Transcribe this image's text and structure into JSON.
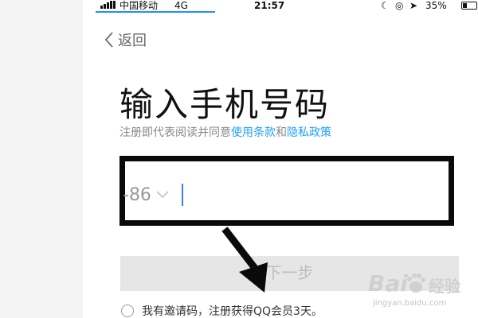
{
  "statusbar": {
    "carrier": "中国移动",
    "network": "4G",
    "time": "21:57",
    "battery": "35%"
  },
  "nav": {
    "back_label": "返回"
  },
  "page": {
    "title": "输入手机号码",
    "agreement_prefix": "注册即代表阅读并同意",
    "terms_link": "使用条款",
    "and_text": "和",
    "privacy_link": "隐私政策"
  },
  "phone_input": {
    "country_code": "-86",
    "value": ""
  },
  "next_button": {
    "label": "下一步"
  },
  "invite": {
    "label": "我有邀请码，注册获得QQ会员3天。"
  },
  "watermark": {
    "brand": "Bai",
    "brand_suffix": "经验",
    "url": "jingyan.baidu.com"
  },
  "colors": {
    "link": "#1ea0ff",
    "cursor": "#3a7bff",
    "button_bg": "#e6e6e6",
    "highlight_box": "#0a0a0a"
  }
}
